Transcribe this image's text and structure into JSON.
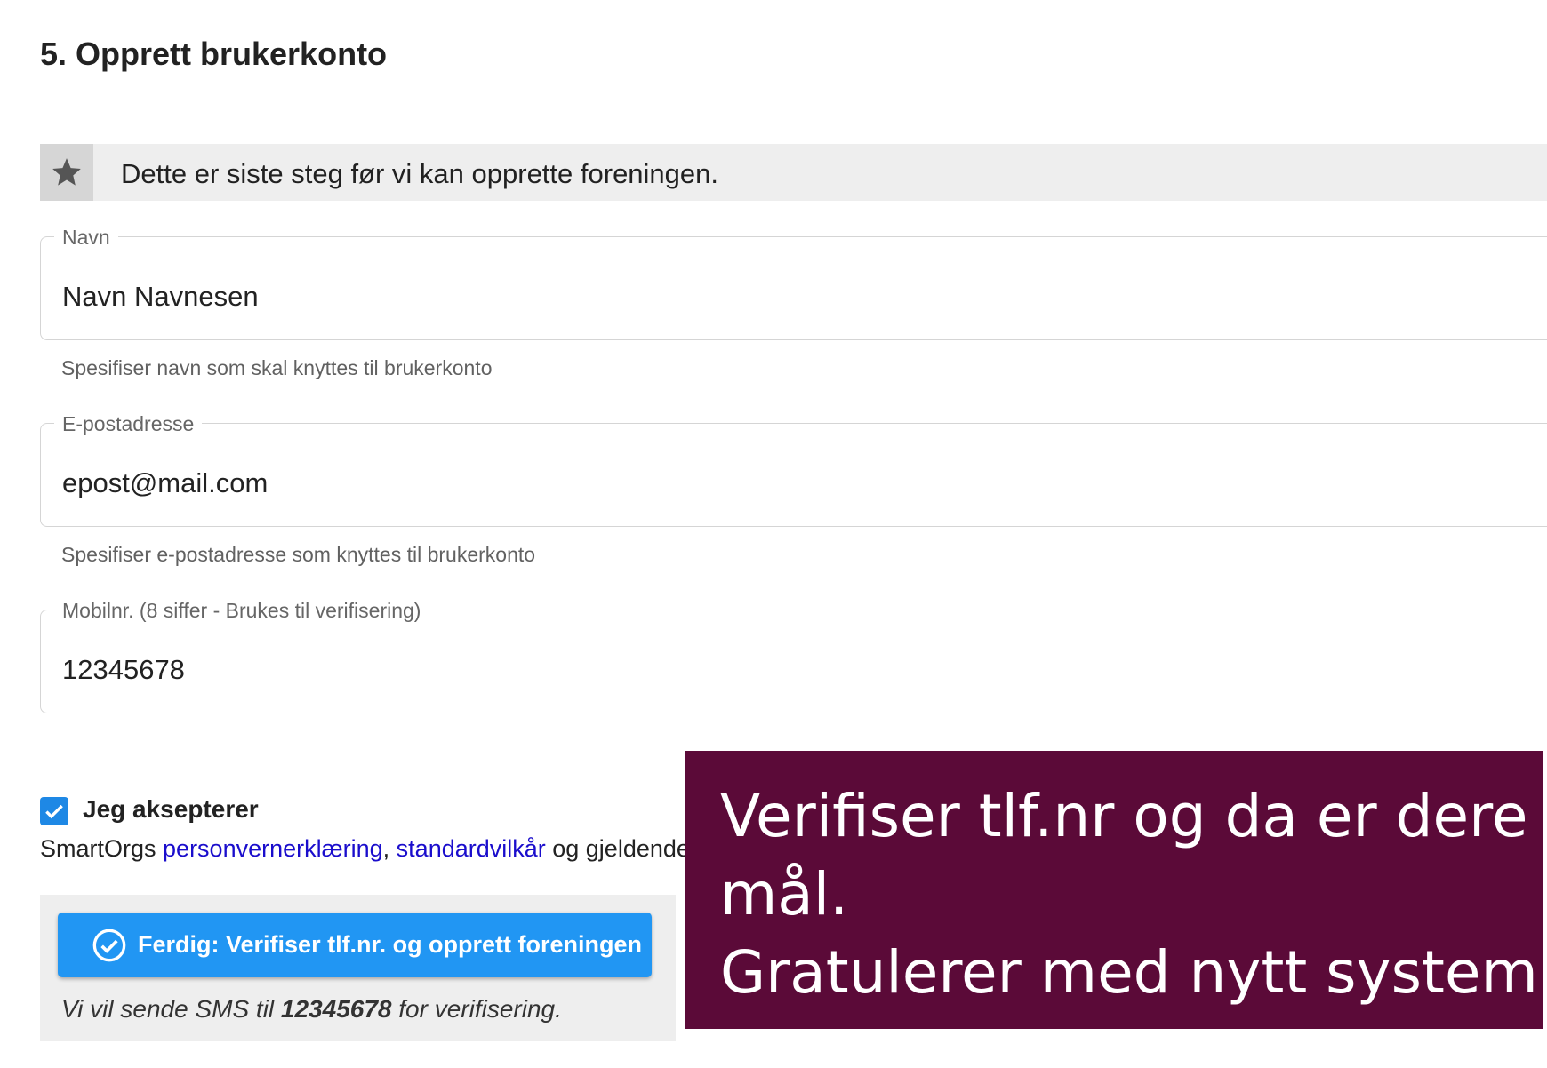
{
  "page": {
    "title": "5. Opprett brukerkonto"
  },
  "info": {
    "icon": "star-icon",
    "text": "Dette er siste steg før vi kan opprette foreningen."
  },
  "fields": {
    "name": {
      "label": "Navn",
      "value": "Navn Navnesen",
      "hint": "Spesifiser navn som skal knyttes til brukerkonto"
    },
    "email": {
      "label": "E-postadresse",
      "value": "epost@mail.com",
      "hint": "Spesifiser e-postadresse som knyttes til brukerkonto"
    },
    "mobile": {
      "label": "Mobilnr. (8 siffer - Brukes til verifisering)",
      "value": "12345678"
    }
  },
  "consent": {
    "checked": true,
    "label": "Jeg aksepterer",
    "prefix": "SmartOrgs ",
    "privacy_link": "personvernerklæring",
    "separator": ", ",
    "terms_link": "standardvilkår",
    "suffix": " og gjeldende"
  },
  "finish": {
    "button_label": "Ferdig: Verifiser tlf.nr. og opprett foreningen",
    "sms_prefix": "Vi vil sende SMS til ",
    "sms_number": "12345678",
    "sms_suffix": " for verifisering."
  },
  "overlay": {
    "line1": "Verifiser tlf.nr og da er dere i",
    "line2": "mål.",
    "line3": "Gratulerer med nytt system!"
  },
  "colors": {
    "accent": "#2196f3",
    "link": "#1a0dcc",
    "overlay_bg": "#5b0a38"
  }
}
